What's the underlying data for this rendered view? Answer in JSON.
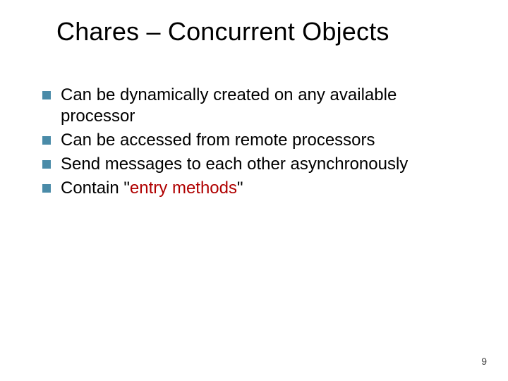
{
  "title": "Chares – Concurrent Objects",
  "bullets": [
    {
      "text": "Can be dynamically created on any available processor"
    },
    {
      "text": "Can be accessed from remote processors"
    },
    {
      "text": "Send messages to each other asynchronously"
    },
    {
      "prefix": "Contain \"",
      "highlight": "entry methods",
      "suffix": "\""
    }
  ],
  "page_number": "9",
  "colors": {
    "bullet": "#4a8ba8",
    "highlight": "#b00000"
  }
}
